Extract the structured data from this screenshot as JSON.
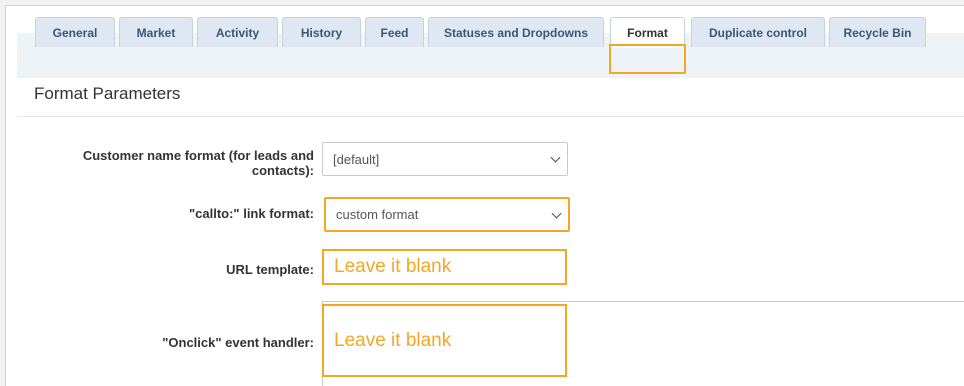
{
  "tabs": [
    {
      "label": "General"
    },
    {
      "label": "Market"
    },
    {
      "label": "Activity"
    },
    {
      "label": "History"
    },
    {
      "label": "Feed"
    },
    {
      "label": "Statuses and Dropdowns"
    },
    {
      "label": "Format"
    },
    {
      "label": "Duplicate control"
    },
    {
      "label": "Recycle Bin"
    }
  ],
  "active_tab": "Format",
  "section": {
    "title": "Format Parameters"
  },
  "form": {
    "customer_name_format": {
      "label": "Customer name format (for leads and contacts):",
      "value": "[default]"
    },
    "callto_link_format": {
      "label": "\"callto:\" link format:",
      "value": "custom format"
    },
    "url_template": {
      "label": "URL template:",
      "annotation": "Leave it blank"
    },
    "onclick_handler": {
      "label": "\"Onclick\" event handler:",
      "annotation": "Leave it blank"
    }
  },
  "colors": {
    "highlight": "#f5a623",
    "tab_text": "#3a5779",
    "tab_bg": "#dfe8f2"
  }
}
